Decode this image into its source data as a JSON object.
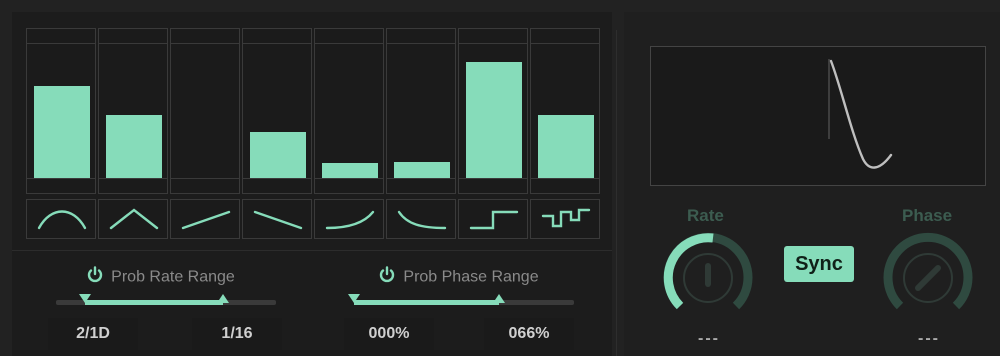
{
  "bars": [
    {
      "level": 0.68,
      "shape": "sine-icon"
    },
    {
      "level": 0.46,
      "shape": "triangle-icon"
    },
    {
      "level": 0.0,
      "shape": "ramp-up-icon"
    },
    {
      "level": 0.34,
      "shape": "ramp-down-icon"
    },
    {
      "level": 0.11,
      "shape": "exp-up-icon"
    },
    {
      "level": 0.12,
      "shape": "exp-down-icon"
    },
    {
      "level": 0.85,
      "shape": "square-icon"
    },
    {
      "level": 0.46,
      "shape": "random-step-icon"
    }
  ],
  "rate_range": {
    "title": "Prob Rate Range",
    "low": "2/1D",
    "high": "1/16",
    "low_pos": 0.13,
    "high_pos": 0.76
  },
  "phase_range": {
    "title": "Prob Phase Range",
    "low": "000%",
    "high": "066%",
    "low_pos": 0.0,
    "high_pos": 0.66
  },
  "rate": {
    "label": "Rate",
    "value": "---"
  },
  "phase": {
    "label": "Phase",
    "value": "---"
  },
  "sync": {
    "label": "Sync"
  },
  "colors": {
    "accent": "#86dcba",
    "dim_label": "#3c5c50"
  }
}
